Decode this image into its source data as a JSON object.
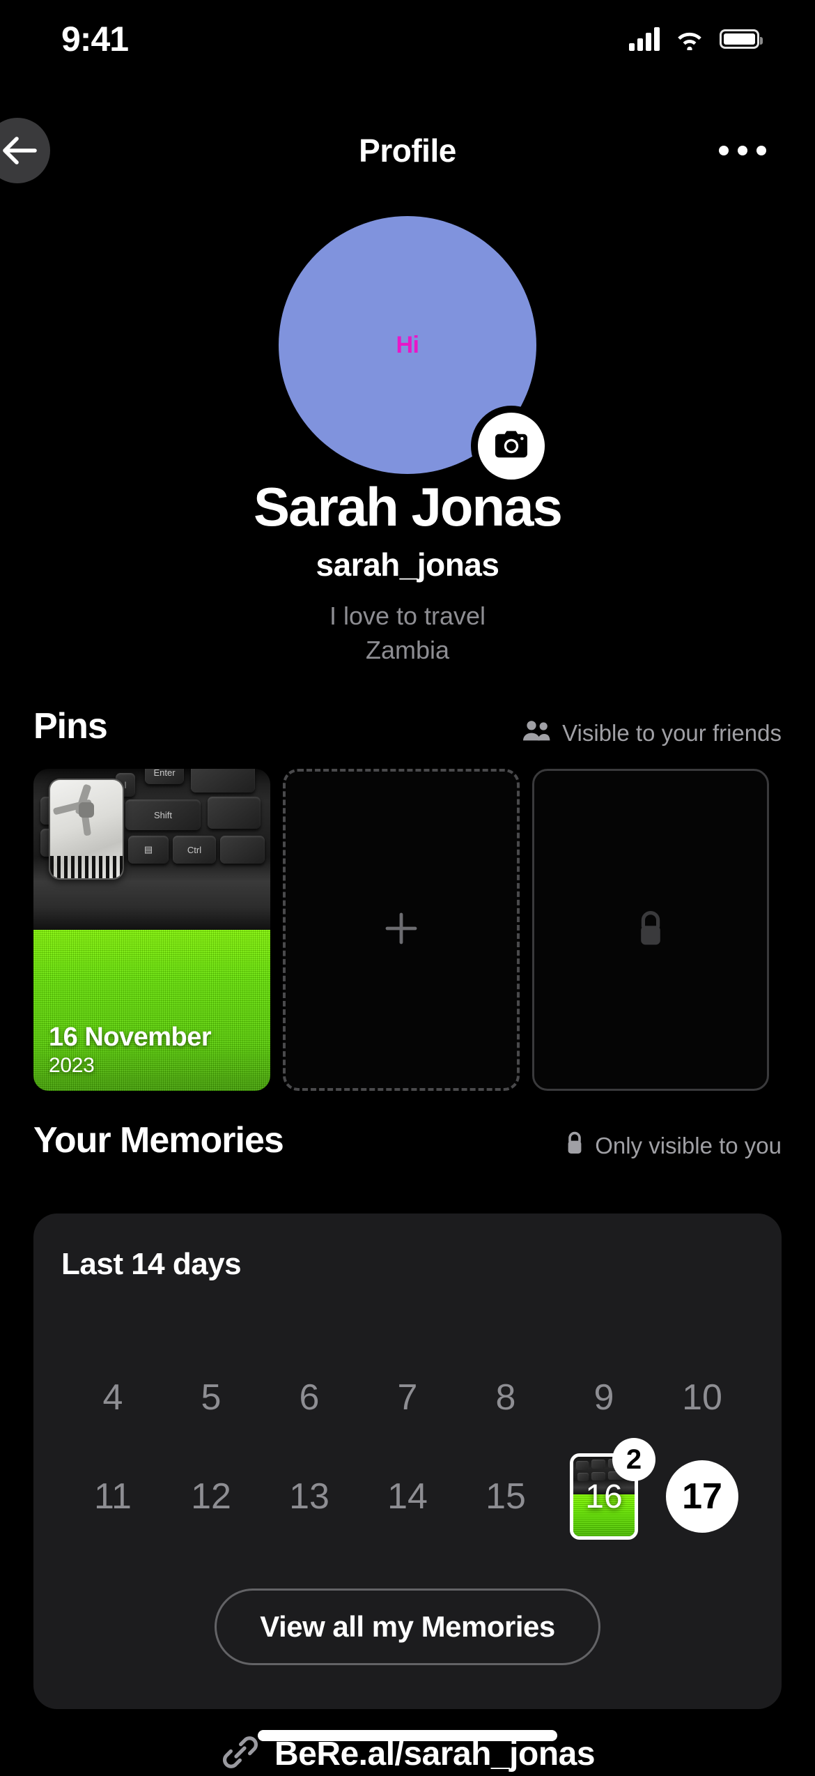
{
  "status_bar": {
    "time": "9:41",
    "cellular_icon": "cellular-signal-icon",
    "wifi_icon": "wifi-icon",
    "battery_icon": "battery-full-icon"
  },
  "header": {
    "back_icon": "back-arrow-icon",
    "title": "Profile",
    "more_icon": "more-options-icon"
  },
  "profile": {
    "avatar_placeholder_text": "Hi",
    "avatar_color": "#8093dd",
    "avatar_text_color": "#e817c8",
    "camera_icon": "camera-icon",
    "name": "Sarah Jonas",
    "username": "sarah_jonas",
    "bio": "I love to travel",
    "location": "Zambia"
  },
  "pins": {
    "title": "Pins",
    "visibility_icon": "people-icon",
    "visibility_label": "Visible to your friends",
    "items": [
      {
        "type": "photo",
        "date_day": "16 November",
        "date_year": "2023"
      },
      {
        "type": "add",
        "icon": "plus-icon"
      },
      {
        "type": "locked",
        "icon": "lock-icon"
      }
    ]
  },
  "memories": {
    "title": "Your Memories",
    "visibility_icon": "lock-icon",
    "visibility_label": "Only visible to you",
    "card_title": "Last 14 days",
    "days_row_1": [
      {
        "label": "4",
        "state": "empty"
      },
      {
        "label": "5",
        "state": "empty"
      },
      {
        "label": "6",
        "state": "empty"
      },
      {
        "label": "7",
        "state": "empty"
      },
      {
        "label": "8",
        "state": "empty"
      },
      {
        "label": "9",
        "state": "empty"
      },
      {
        "label": "10",
        "state": "empty"
      }
    ],
    "days_row_2": [
      {
        "label": "11",
        "state": "empty"
      },
      {
        "label": "12",
        "state": "empty"
      },
      {
        "label": "13",
        "state": "empty"
      },
      {
        "label": "14",
        "state": "empty"
      },
      {
        "label": "15",
        "state": "empty"
      },
      {
        "label": "16",
        "state": "photo",
        "badge_count": "2"
      },
      {
        "label": "17",
        "state": "today"
      }
    ],
    "view_all_label": "View all my Memories"
  },
  "bottom": {
    "link_icon": "link-icon",
    "link_label": "BeRe.al/sarah_jonas"
  }
}
